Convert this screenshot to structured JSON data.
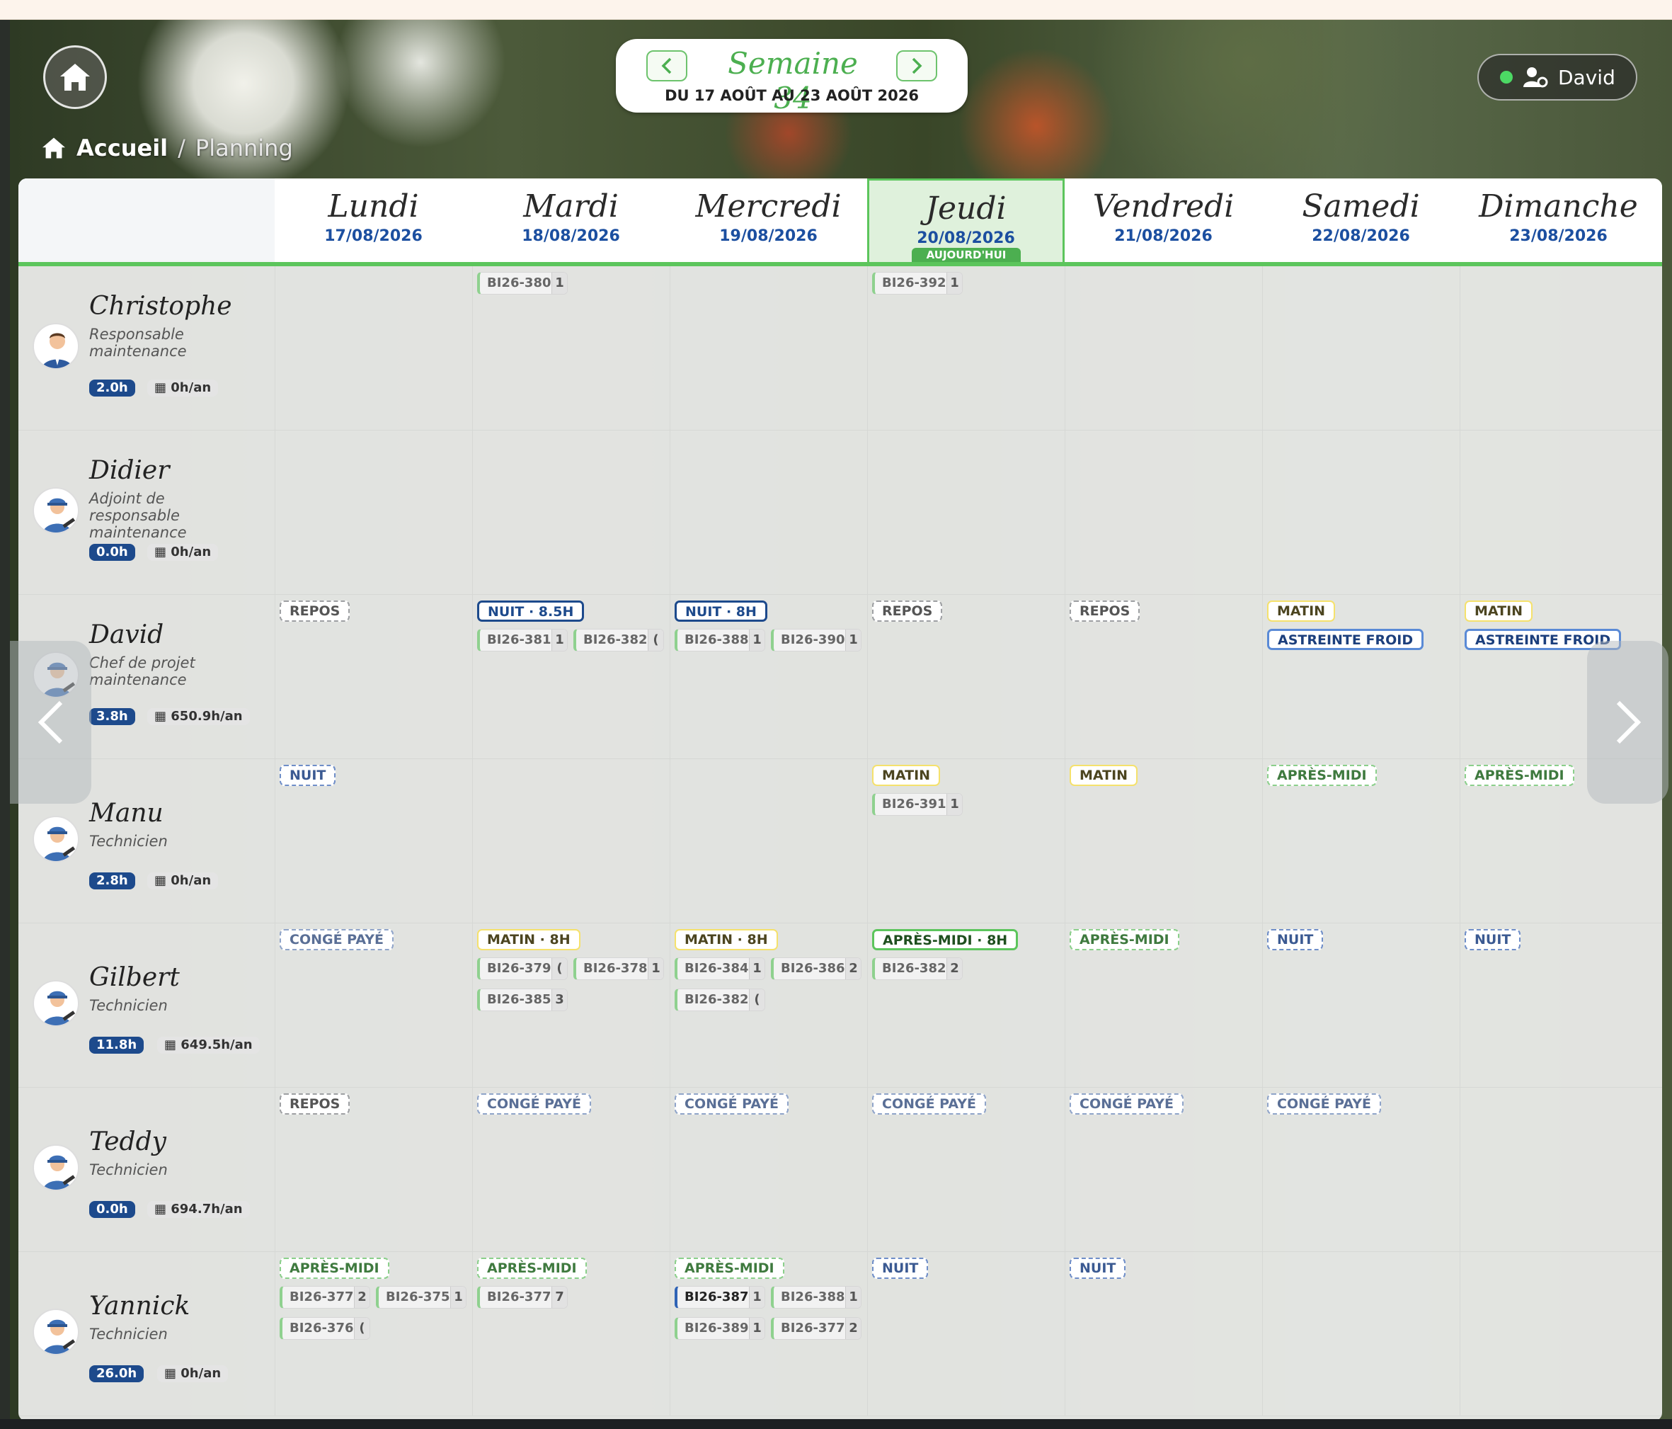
{
  "week": {
    "title": "Semaine 34",
    "range": "DU 17 AOÛT AU 23 AOÛT 2026"
  },
  "user": {
    "name": "David"
  },
  "breadcrumb": {
    "home": "Accueil",
    "sep": "/",
    "current": "Planning"
  },
  "today_label": "AUJOURD'HUI",
  "days": [
    {
      "name": "Lundi",
      "date": "17/08/2026"
    },
    {
      "name": "Mardi",
      "date": "18/08/2026"
    },
    {
      "name": "Mercredi",
      "date": "19/08/2026"
    },
    {
      "name": "Jeudi",
      "date": "20/08/2026",
      "today": true
    },
    {
      "name": "Vendredi",
      "date": "21/08/2026"
    },
    {
      "name": "Samedi",
      "date": "22/08/2026"
    },
    {
      "name": "Dimanche",
      "date": "23/08/2026"
    }
  ],
  "colors": {
    "accent": "#5cc55c",
    "navy": "#1d4a8c"
  },
  "people": [
    {
      "name": "Christophe",
      "role": "Responsable maintenance",
      "hours": "2.0h",
      "annual": "0h/an",
      "avatar": "manager-avatar-icon",
      "days": [
        {
          "tags": [],
          "bi": []
        },
        {
          "tags": [],
          "bi": [
            {
              "id": "BI26-380",
              "c": "1"
            }
          ]
        },
        {
          "tags": [],
          "bi": []
        },
        {
          "tags": [],
          "bi": [
            {
              "id": "BI26-392",
              "c": "1"
            }
          ]
        },
        {
          "tags": [],
          "bi": []
        },
        {
          "tags": [],
          "bi": []
        },
        {
          "tags": [],
          "bi": []
        }
      ]
    },
    {
      "name": "Didier",
      "role": "Adjoint de responsable maintenance",
      "hours": "0.0h",
      "annual": "0h/an",
      "avatar": "technician-avatar-icon",
      "days": [
        {
          "tags": [],
          "bi": []
        },
        {
          "tags": [],
          "bi": []
        },
        {
          "tags": [],
          "bi": []
        },
        {
          "tags": [],
          "bi": []
        },
        {
          "tags": [],
          "bi": []
        },
        {
          "tags": [],
          "bi": []
        },
        {
          "tags": [],
          "bi": []
        }
      ]
    },
    {
      "name": "David",
      "role": "Chef de projet maintenance",
      "hours": "3.8h",
      "annual": "650.9h/an",
      "avatar": "technician-avatar-icon",
      "days": [
        {
          "tags": [
            {
              "t": "REPOS",
              "k": "repos"
            }
          ],
          "bi": []
        },
        {
          "tags": [
            {
              "t": "NUIT · 8.5H",
              "k": "nuitS"
            }
          ],
          "bi": [
            {
              "id": "BI26-381",
              "c": "1"
            },
            {
              "id": "BI26-382",
              "c": "("
            }
          ]
        },
        {
          "tags": [
            {
              "t": "NUIT · 8H",
              "k": "nuitS"
            }
          ],
          "bi": [
            {
              "id": "BI26-388",
              "c": "1"
            },
            {
              "id": "BI26-390",
              "c": "1"
            }
          ]
        },
        {
          "tags": [
            {
              "t": "REPOS",
              "k": "repos"
            }
          ],
          "bi": []
        },
        {
          "tags": [
            {
              "t": "REPOS",
              "k": "repos"
            }
          ],
          "bi": []
        },
        {
          "tags": [
            {
              "t": "MATIN",
              "k": "matin"
            },
            {
              "t": "ASTREINTE FROID",
              "k": "astr"
            }
          ],
          "bi": []
        },
        {
          "tags": [
            {
              "t": "MATIN",
              "k": "matin"
            },
            {
              "t": "ASTREINTE FROID",
              "k": "astr"
            }
          ],
          "bi": []
        }
      ]
    },
    {
      "name": "Manu",
      "role": "Technicien",
      "hours": "2.8h",
      "annual": "0h/an",
      "avatar": "technician-avatar-icon",
      "days": [
        {
          "tags": [
            {
              "t": "NUIT",
              "k": "nuit-d"
            }
          ],
          "bi": []
        },
        {
          "tags": [],
          "bi": []
        },
        {
          "tags": [],
          "bi": []
        },
        {
          "tags": [
            {
              "t": "MATIN",
              "k": "matin"
            }
          ],
          "bi": [
            {
              "id": "BI26-391",
              "c": "1"
            }
          ]
        },
        {
          "tags": [
            {
              "t": "MATIN",
              "k": "matin"
            }
          ],
          "bi": []
        },
        {
          "tags": [
            {
              "t": "APRÈS-MIDI",
              "k": "apm-d"
            }
          ],
          "bi": []
        },
        {
          "tags": [
            {
              "t": "APRÈS-MIDI",
              "k": "apm-d"
            }
          ],
          "bi": []
        }
      ]
    },
    {
      "name": "Gilbert",
      "role": "Technicien",
      "hours": "11.8h",
      "annual": "649.5h/an",
      "avatar": "technician-avatar-icon",
      "days": [
        {
          "tags": [
            {
              "t": "CONGÉ PAYÉ",
              "k": "conge"
            }
          ],
          "bi": []
        },
        {
          "tags": [
            {
              "t": "MATIN · 8H",
              "k": "matin"
            }
          ],
          "bi": [
            {
              "id": "BI26-379",
              "c": "("
            },
            {
              "id": "BI26-378",
              "c": "1"
            },
            {
              "id": "BI26-385",
              "c": "3"
            }
          ]
        },
        {
          "tags": [
            {
              "t": "MATIN · 8H",
              "k": "matin"
            }
          ],
          "bi": [
            {
              "id": "BI26-384",
              "c": "1"
            },
            {
              "id": "BI26-386",
              "c": "2"
            },
            {
              "id": "BI26-382",
              "c": "("
            }
          ]
        },
        {
          "tags": [
            {
              "t": "APRÈS-MIDI · 8H",
              "k": "apmS"
            }
          ],
          "bi": [
            {
              "id": "BI26-382",
              "c": "2"
            }
          ]
        },
        {
          "tags": [
            {
              "t": "APRÈS-MIDI",
              "k": "apm-d"
            }
          ],
          "bi": []
        },
        {
          "tags": [
            {
              "t": "NUIT",
              "k": "nuit-d"
            }
          ],
          "bi": []
        },
        {
          "tags": [
            {
              "t": "NUIT",
              "k": "nuit-d"
            }
          ],
          "bi": []
        }
      ]
    },
    {
      "name": "Teddy",
      "role": "Technicien",
      "hours": "0.0h",
      "annual": "694.7h/an",
      "avatar": "technician-avatar-icon",
      "days": [
        {
          "tags": [
            {
              "t": "REPOS",
              "k": "repos"
            }
          ],
          "bi": []
        },
        {
          "tags": [
            {
              "t": "CONGÉ PAYÉ",
              "k": "conge"
            }
          ],
          "bi": []
        },
        {
          "tags": [
            {
              "t": "CONGÉ PAYÉ",
              "k": "conge"
            }
          ],
          "bi": []
        },
        {
          "tags": [
            {
              "t": "CONGÉ PAYÉ",
              "k": "conge"
            }
          ],
          "bi": []
        },
        {
          "tags": [
            {
              "t": "CONGÉ PAYÉ",
              "k": "conge"
            }
          ],
          "bi": []
        },
        {
          "tags": [
            {
              "t": "CONGÉ PAYÉ",
              "k": "conge"
            }
          ],
          "bi": []
        },
        {
          "tags": [],
          "bi": []
        }
      ]
    },
    {
      "name": "Yannick",
      "role": "Technicien",
      "hours": "26.0h",
      "annual": "0h/an",
      "avatar": "technician-avatar-icon",
      "days": [
        {
          "tags": [
            {
              "t": "APRÈS-MIDI",
              "k": "apm-d"
            }
          ],
          "bi": [
            {
              "id": "BI26-377",
              "c": "2"
            },
            {
              "id": "BI26-375",
              "c": "1"
            },
            {
              "id": "BI26-376",
              "c": "("
            }
          ]
        },
        {
          "tags": [
            {
              "t": "APRÈS-MIDI",
              "k": "apm-d"
            }
          ],
          "bi": [
            {
              "id": "BI26-377",
              "c": "7"
            }
          ]
        },
        {
          "tags": [
            {
              "t": "APRÈS-MIDI",
              "k": "apm-d"
            }
          ],
          "bi": [
            {
              "id": "BI26-387",
              "c": "1",
              "blue": true
            },
            {
              "id": "BI26-388",
              "c": "1"
            },
            {
              "id": "BI26-389",
              "c": "1"
            },
            {
              "id": "BI26-377",
              "c": "2"
            }
          ]
        },
        {
          "tags": [
            {
              "t": "NUIT",
              "k": "nuit-d"
            }
          ],
          "bi": []
        },
        {
          "tags": [
            {
              "t": "NUIT",
              "k": "nuit-d"
            }
          ],
          "bi": []
        },
        {
          "tags": [],
          "bi": []
        },
        {
          "tags": [],
          "bi": []
        }
      ]
    }
  ]
}
